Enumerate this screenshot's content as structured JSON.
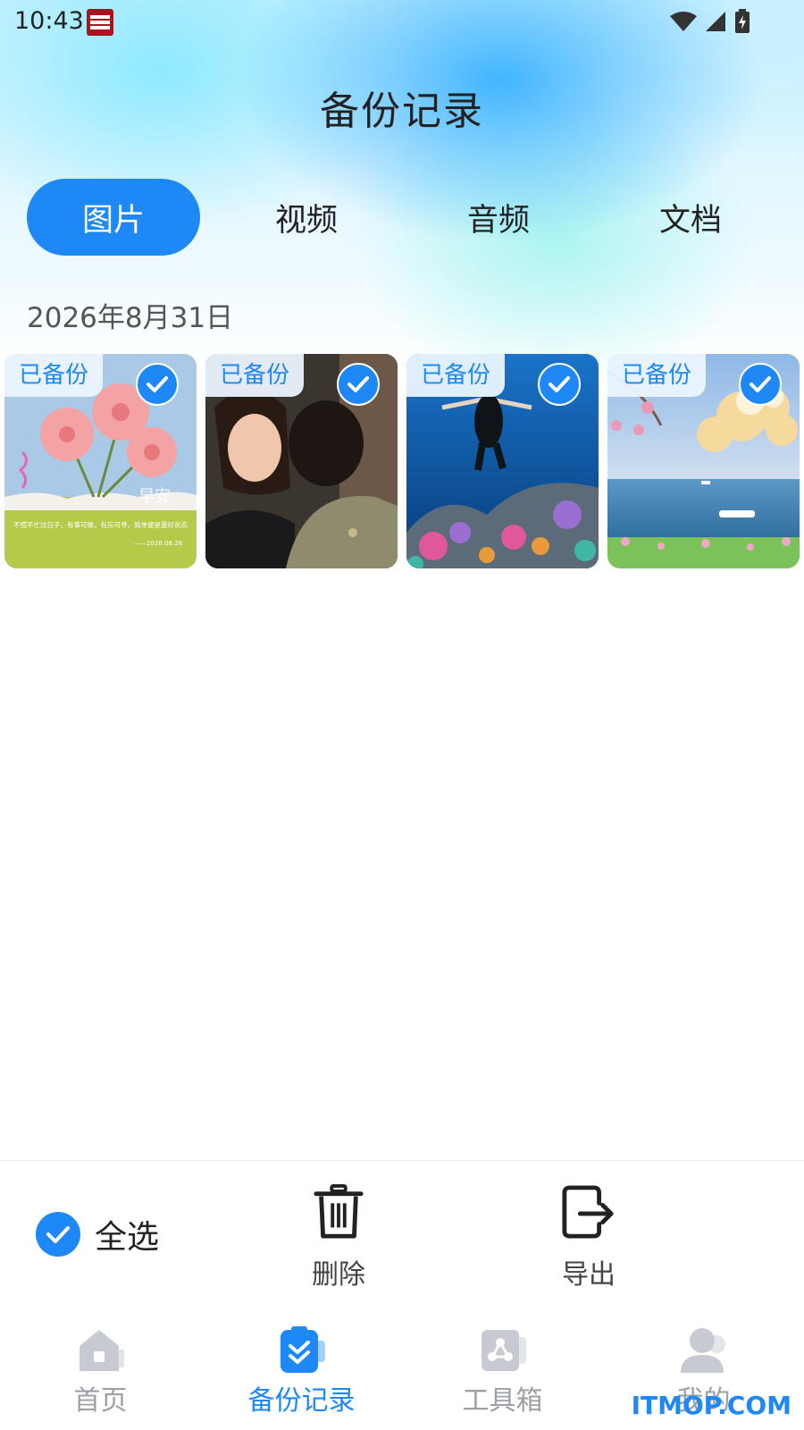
{
  "status_bar": {
    "time": "10:43"
  },
  "header": {
    "title": "备份记录"
  },
  "tabs": [
    {
      "label": "图片",
      "active": true
    },
    {
      "label": "视频",
      "active": false
    },
    {
      "label": "音频",
      "active": false
    },
    {
      "label": "文档",
      "active": false
    }
  ],
  "group": {
    "date": "2026年8月31日",
    "photos": [
      {
        "badge": "已备份",
        "selected": true,
        "caption": "不慌不忙过日子，有事可做，有乐可寻，简单便是最好状态",
        "caption_date": "——2026.08.26",
        "overlay_text": "早安"
      },
      {
        "badge": "已备份",
        "selected": true
      },
      {
        "badge": "已备份",
        "selected": true
      },
      {
        "badge": "已备份",
        "selected": true
      }
    ]
  },
  "actions": {
    "select_all": "全选",
    "delete": "删除",
    "export": "导出"
  },
  "bottom_nav": [
    {
      "label": "首页",
      "icon": "home-icon",
      "active": false
    },
    {
      "label": "备份记录",
      "icon": "backup-record-icon",
      "active": true
    },
    {
      "label": "工具箱",
      "icon": "toolbox-icon",
      "active": false
    },
    {
      "label": "我的",
      "icon": "profile-icon",
      "active": false
    }
  ],
  "watermark": "ITMOP.COM",
  "colors": {
    "accent": "#1f88f7",
    "inactive": "#9aa0a6"
  }
}
